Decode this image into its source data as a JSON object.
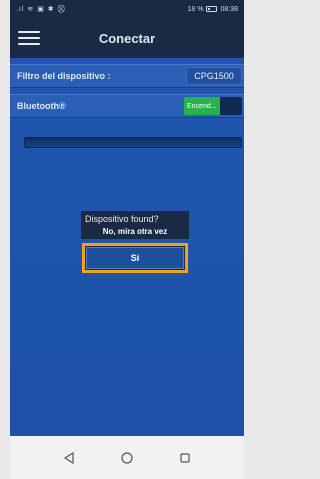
{
  "status_bar": {
    "signal_text": ".ıl ≋ ▣ ✱ ⛒",
    "battery_text": "18 %",
    "time": "08:38"
  },
  "app_bar": {
    "title": "Conectar",
    "menu_icon": "hamburger-menu-icon"
  },
  "filter_row": {
    "label": "Filtro del dispositivo :",
    "value": "CPG1500"
  },
  "bluetooth_row": {
    "label": "Bluetooth®",
    "toggle_label": "Encend..."
  },
  "progress": {
    "value": 0
  },
  "dialog": {
    "title": "Dispositivo found?",
    "no_label": "No, mira otra vez",
    "yes_label": "Si"
  },
  "nav_bar": {
    "icons": [
      "back-triangle-icon",
      "home-circle-icon",
      "recent-square-icon"
    ]
  },
  "colors": {
    "app_blue": "#1e52a8",
    "dark_bar": "#1b2a44",
    "toggle_green": "#27b24c",
    "highlight_orange": "#f0a21c"
  }
}
